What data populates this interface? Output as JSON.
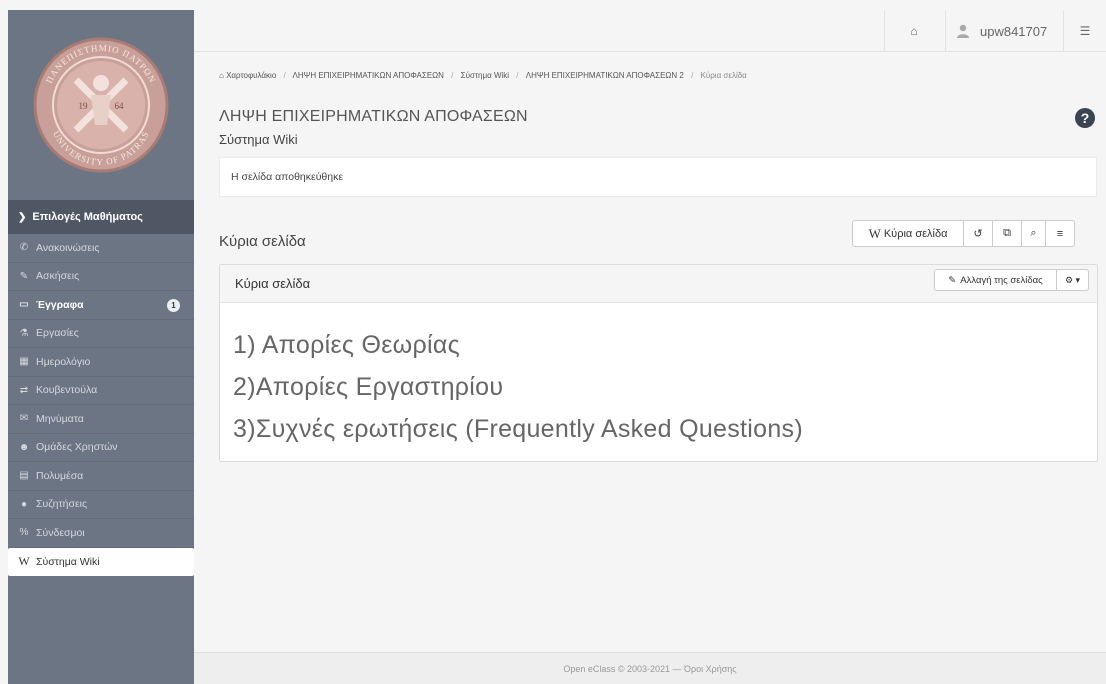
{
  "sidebar": {
    "seal": {
      "top_text": "ΠΑΝΕΠΙΣΤΗΜΙΟ ΠΑΤΡΩΝ",
      "bottom_text": "UNIVERSITY OF PATRAS",
      "year_left": "19",
      "year_right": "64"
    },
    "section_header": "Επιλογές Μαθήματος",
    "items": [
      {
        "label": "Ανακοινώσεις",
        "icon": "bullhorn-icon",
        "glyph": "✆"
      },
      {
        "label": "Ασκήσεις",
        "icon": "edit-icon",
        "glyph": "✎"
      },
      {
        "label": "Έγγραφα",
        "icon": "folder-icon",
        "glyph": "▭",
        "badge": "1"
      },
      {
        "label": "Εργασίες",
        "icon": "flask-icon",
        "glyph": "⚗"
      },
      {
        "label": "Ημερολόγιο",
        "icon": "calendar-icon",
        "glyph": "▦"
      },
      {
        "label": "Κουβεντούλα",
        "icon": "exchange-icon",
        "glyph": "⇄"
      },
      {
        "label": "Μηνύματα",
        "icon": "envelope-icon",
        "glyph": "✉"
      },
      {
        "label": "Ομάδες Χρηστών",
        "icon": "users-icon",
        "glyph": "☻"
      },
      {
        "label": "Πολυμέσα",
        "icon": "film-icon",
        "glyph": "▤"
      },
      {
        "label": "Συζητήσεις",
        "icon": "comments-icon",
        "glyph": "●"
      },
      {
        "label": "Σύνδεσμοι",
        "icon": "link-icon",
        "glyph": "%"
      },
      {
        "label": "Σύστημα Wiki",
        "icon": "wikipedia-icon",
        "glyph": "W"
      }
    ]
  },
  "topbar": {
    "username": "upw841707",
    "home_glyph": "⌂",
    "toggle_glyph": "☰"
  },
  "breadcrumb": {
    "home_glyph": "⌂",
    "items": [
      "Χαρτοφυλάκιο",
      "ΛΗΨΗ ΕΠΙΧΕΙΡΗΜΑΤΙΚΩΝ ΑΠΟΦΑΣΕΩΝ",
      "Σύστημα Wiki",
      "ΛΗΨΗ ΕΠΙΧΕΙΡΗΜΑΤΙΚΩΝ ΑΠΟΦΑΣΕΩΝ 2"
    ],
    "current": "Κύρια σελίδα",
    "separator": "/"
  },
  "header": {
    "course_title": "ΛΗΨΗ ΕΠΙΧΕΙΡΗΜΑΤΙΚΩΝ ΑΠΟΦΑΣΕΩΝ",
    "subtitle": "Σύστημα Wiki"
  },
  "alert": {
    "message": "Η σελίδα αποθηκεύθηκε"
  },
  "page": {
    "heading": "Κύρια σελίδα"
  },
  "toolbar": {
    "main_page_label": "Κύρια σελίδα",
    "wiki_glyph": "W",
    "history_glyph": "↺",
    "copy_glyph": "⧉",
    "search_glyph": "⌕",
    "list_glyph": "≡"
  },
  "panel": {
    "title": "Κύρια σελίδα",
    "edit_label": "Αλλαγή της σελίδας",
    "edit_glyph": "✎",
    "settings_glyph": "⚙ ▾",
    "lines": [
      "1) Απορίες Θεωρίας",
      "2)Απορίες Εργαστηρίου",
      "3)Συχνές ερωτήσεις (Frequently Asked Questions)"
    ]
  },
  "footer": {
    "text": "Open eClass © 2003-2021 — Όροι Χρήσης"
  },
  "colors": {
    "sidebar": "#6c7584",
    "sidebar_header": "#4f5765",
    "help": "#3a4453",
    "seal": "#c9a099"
  }
}
